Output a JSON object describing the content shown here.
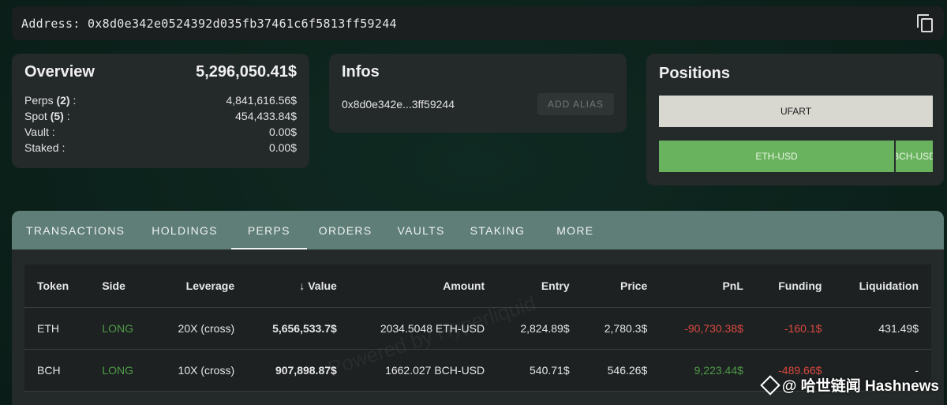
{
  "address_bar": {
    "label": "Address: 0x8d0e342e0524392d035fb37461c6f5813ff59244",
    "copy_icon": "copy-icon"
  },
  "overview": {
    "title": "Overview",
    "total": "5,296,050.41$",
    "rows": [
      {
        "label": "Perps",
        "count": "(2)",
        "suffix": " :",
        "value": "4,841,616.56$"
      },
      {
        "label": "Spot",
        "count": "(5)",
        "suffix": " :",
        "value": "454,433.84$"
      },
      {
        "label": "Vault :",
        "count": "",
        "suffix": "",
        "value": "0.00$"
      },
      {
        "label": "Staked :",
        "count": "",
        "suffix": "",
        "value": "0.00$"
      }
    ]
  },
  "infos": {
    "title": "Infos",
    "address_short": "0x8d0e342e...3ff59244",
    "add_alias_label": "ADD ALIAS"
  },
  "positions": {
    "title": "Positions",
    "items": [
      {
        "label": "UFART",
        "color": "#d8d7d0"
      },
      {
        "label": "ETH-USD",
        "color": "#6ab35e"
      },
      {
        "label": "BCH-USD",
        "color": "#6ab35e"
      }
    ]
  },
  "tabs": [
    {
      "label": "TRANSACTIONS",
      "active": false
    },
    {
      "label": "HOLDINGS",
      "active": false
    },
    {
      "label": "PERPS",
      "active": true
    },
    {
      "label": "ORDERS",
      "active": false
    },
    {
      "label": "VAULTS",
      "active": false
    },
    {
      "label": "STAKING",
      "active": false
    },
    {
      "label": "MORE",
      "active": false
    }
  ],
  "table": {
    "columns": [
      "Token",
      "Side",
      "Leverage",
      "Value",
      "Amount",
      "Entry",
      "Price",
      "PnL",
      "Funding",
      "Liquidation"
    ],
    "sort_icon": "arrow-down-icon",
    "rows": [
      {
        "token": "ETH",
        "side": "LONG",
        "leverage": "20X (cross)",
        "value": "5,656,533.7$",
        "amount": "2034.5048 ETH-USD",
        "entry": "2,824.89$",
        "price": "2,780.3$",
        "pnl": "-90,730.38$",
        "funding": "-160.1$",
        "liquidation": "431.49$"
      },
      {
        "token": "BCH",
        "side": "LONG",
        "leverage": "10X (cross)",
        "value": "907,898.87$",
        "amount": "1662.027 BCH-USD",
        "entry": "540.71$",
        "price": "546.26$",
        "pnl": "9,223.44$",
        "funding": "-489.66$",
        "liquidation": "-"
      }
    ]
  },
  "watermark": "Powered by Hyperliquid",
  "sticker": "@ 哈世链闻 Hashnews",
  "colors": {
    "accent_tab": "#5f7e77",
    "long": "#4f9a47",
    "negative": "#d9493f",
    "card_bg": "#24292a"
  }
}
